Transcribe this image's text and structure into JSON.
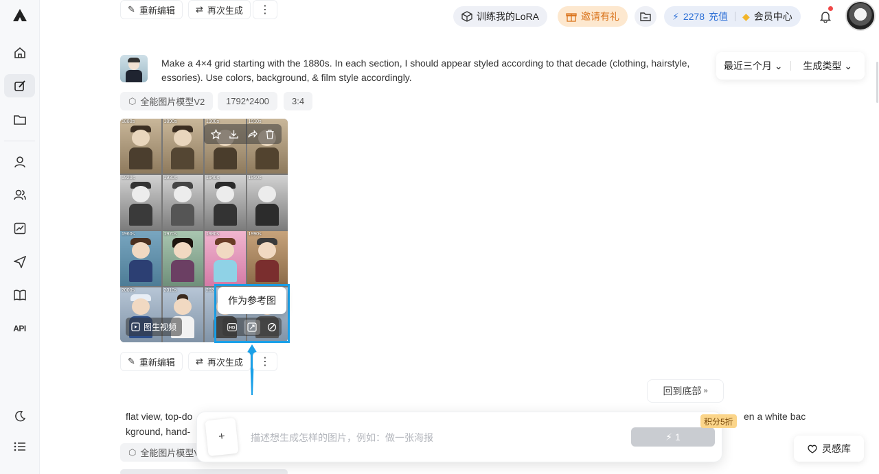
{
  "sidebar": {
    "icons": [
      "app-logo-icon",
      "home-icon",
      "brush-edit-icon",
      "folder-icon",
      "user-icon",
      "users-icon",
      "analytics-icon",
      "send-icon",
      "book-icon"
    ],
    "api_label": "API",
    "bottom_icons": [
      "dark-mode-icon",
      "list-icon"
    ]
  },
  "top_actions": {
    "reedit": "重新编辑",
    "regenerate": "再次生成",
    "more": "⋮"
  },
  "header": {
    "lora": "训练我的LoRA",
    "invite": "邀请有礼",
    "credits": "2278",
    "recharge": "充值",
    "member": "会员中心"
  },
  "filters": {
    "time": "最近三个月",
    "type": "生成类型"
  },
  "prompt": {
    "text": "Make a 4×4 grid starting with the 1880s. In each section, I should appear styled according to that decade (clothing, hairstyle, essories). Use colors, background, & film style accordingly.",
    "tags": [
      "全能图片模型V2",
      "1792*2400",
      "3:4"
    ]
  },
  "image": {
    "years": [
      "1880s",
      "1890s",
      "1900s",
      "1910s",
      "1920s",
      "1930s",
      "1940s",
      "1950s",
      "1960s",
      "1970s",
      "1980s",
      "1990s",
      "2000s",
      "2010s",
      "202",
      ""
    ],
    "video_btn": "图生视频",
    "tooltip": "作为参考图"
  },
  "bottom_actions": {
    "reedit": "重新编辑",
    "regenerate": "再次生成",
    "more": "⋮"
  },
  "back_to_bottom": "回到底部",
  "prompt2": {
    "left": "flat view, top-do",
    "left2": "kground, hand-",
    "right": "en a white bac",
    "tag": "全能图片模型V"
  },
  "composer": {
    "plus": "+",
    "placeholder": "描述想生成怎样的图片，例如：做一张海报",
    "send_count": "1",
    "discount": "积分5折"
  },
  "inspiration": "灵感库",
  "colors": {
    "accent": "#2c6fd6",
    "highlight": "#1aa0e8",
    "invite_text": "#d9731b"
  }
}
